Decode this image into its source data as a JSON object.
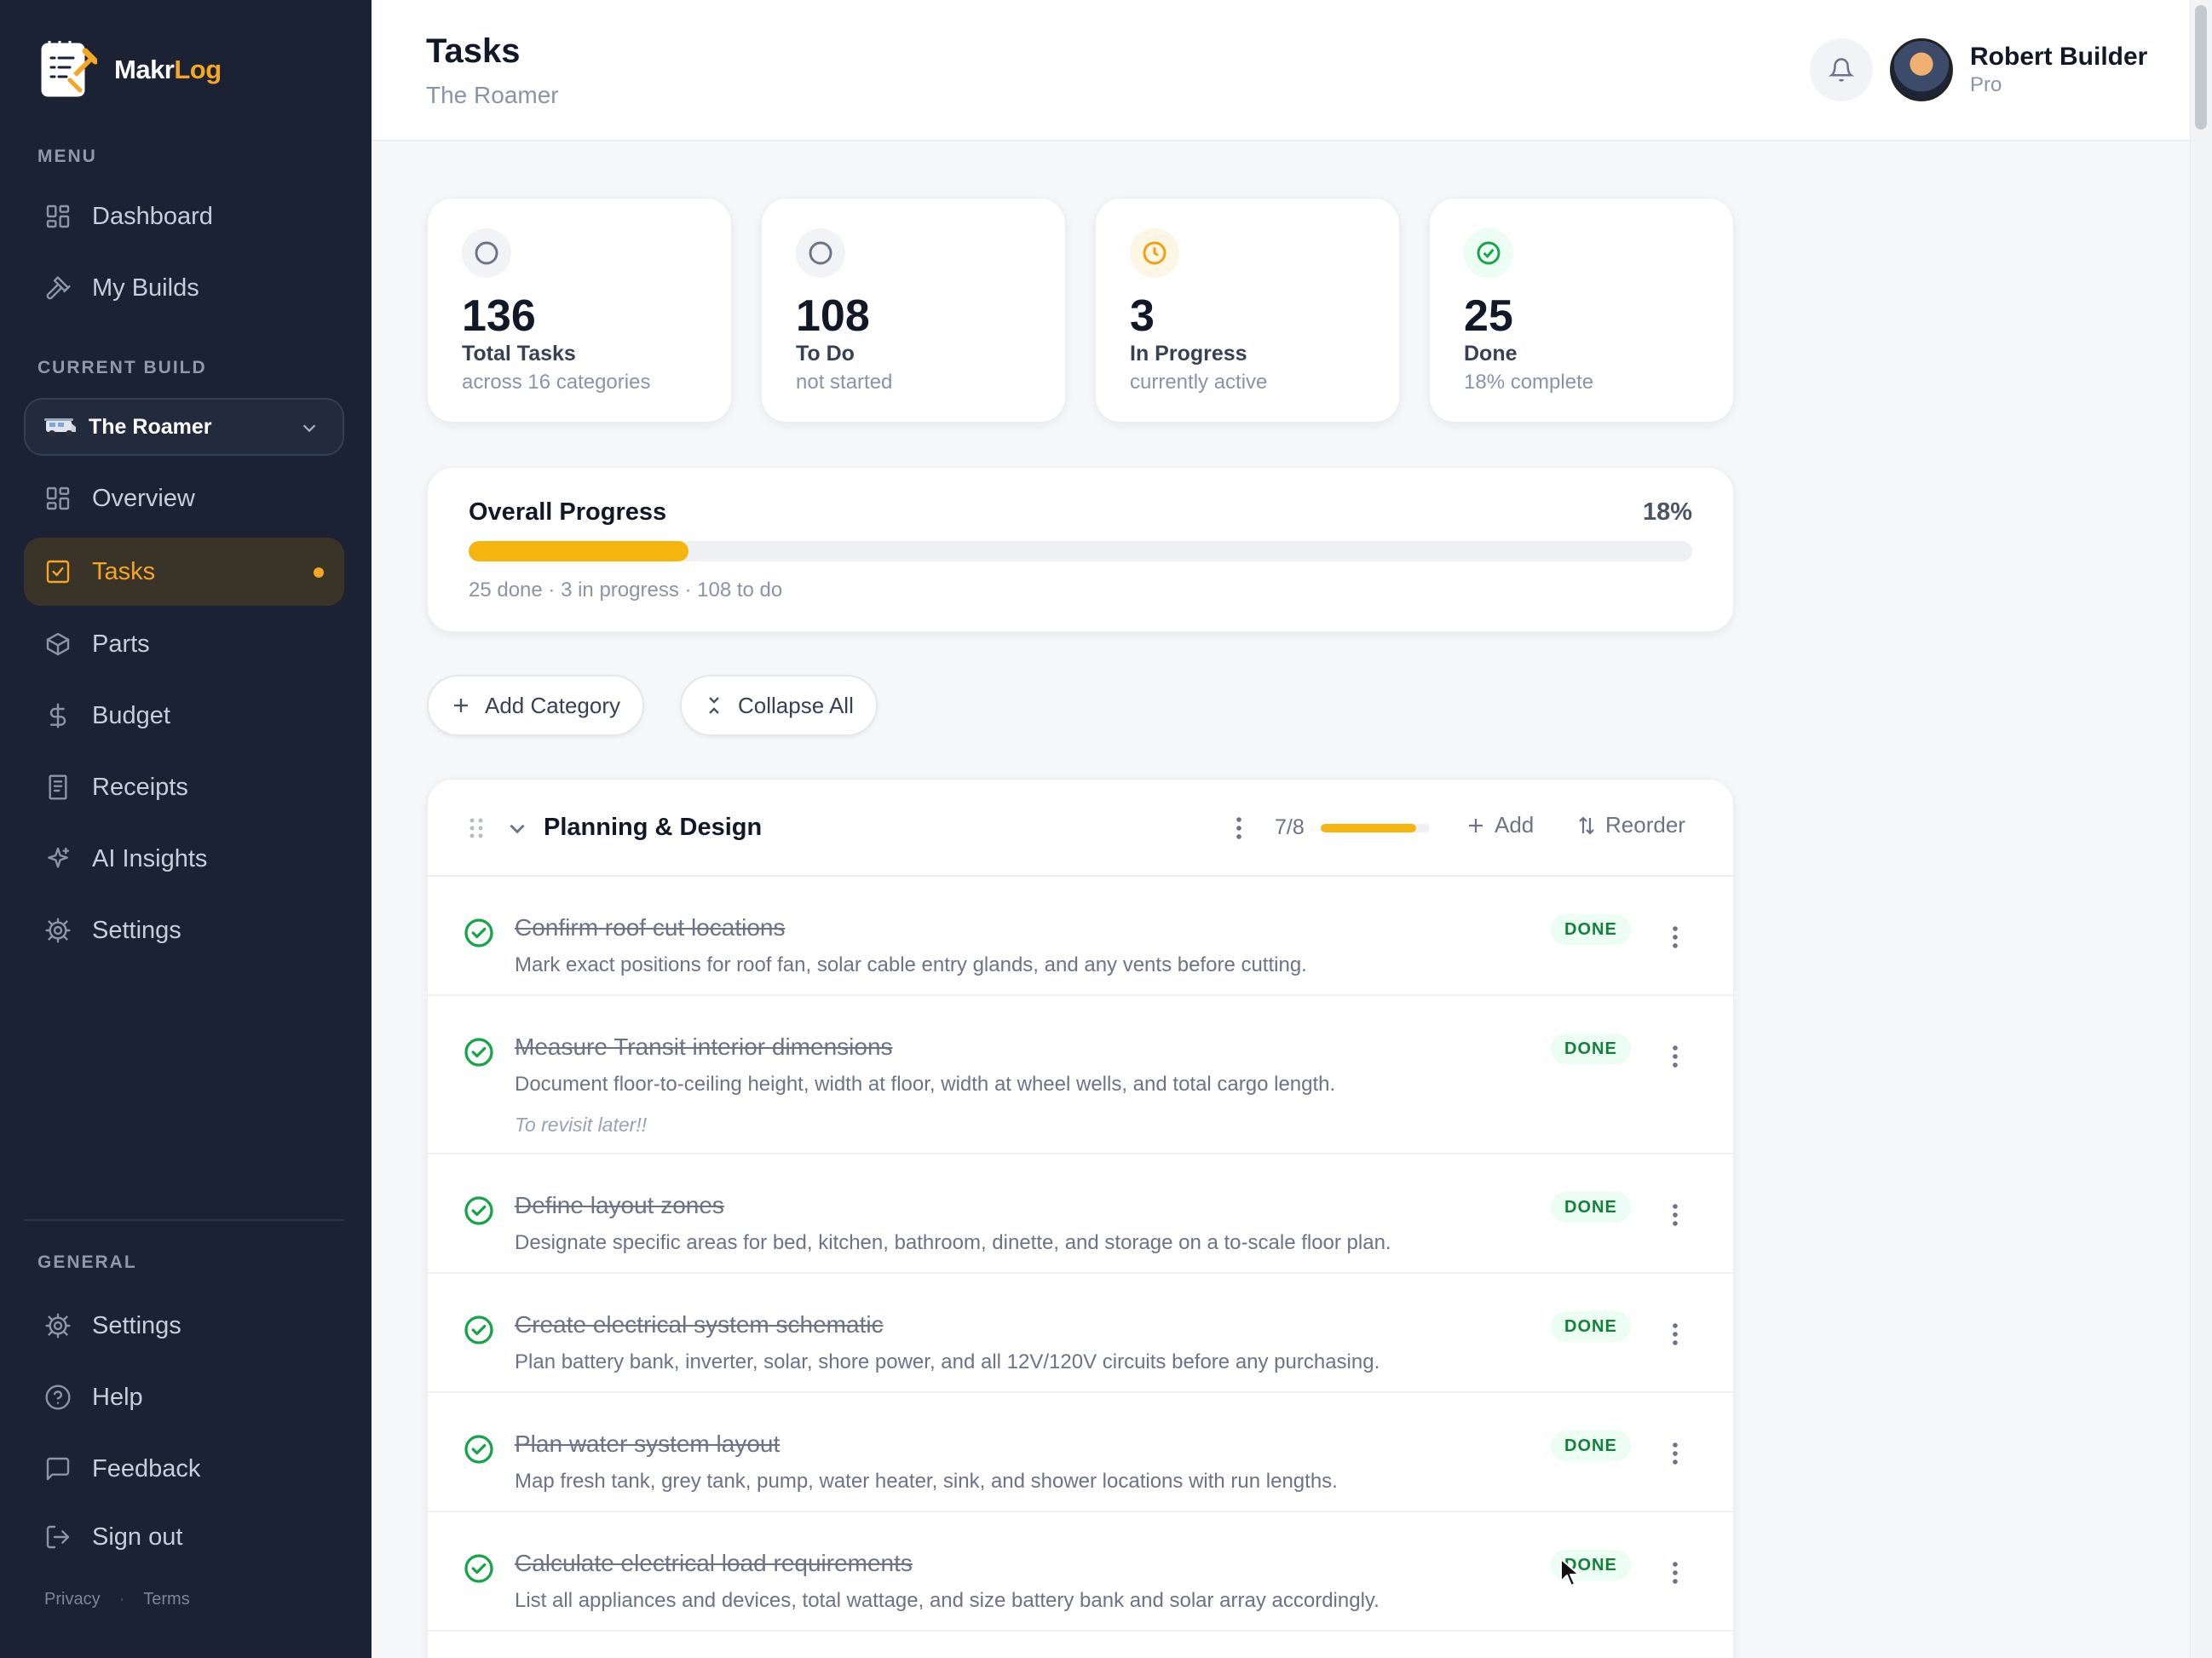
{
  "app": {
    "logo_prefix": "Makr",
    "logo_suffix": "Log",
    "accent_color": "#f5a623"
  },
  "sidebar": {
    "menu_label": "MENU",
    "menu_items": [
      {
        "label": "Dashboard",
        "icon": "grid-icon"
      },
      {
        "label": "My Builds",
        "icon": "hammer-icon"
      }
    ],
    "current_build_label": "CURRENT BUILD",
    "build_selector": {
      "value": "The Roamer",
      "icon": "van-icon"
    },
    "build_items": [
      {
        "label": "Overview",
        "icon": "grid-icon"
      },
      {
        "label": "Tasks",
        "icon": "checkbox-icon",
        "active": true
      },
      {
        "label": "Parts",
        "icon": "box-icon"
      },
      {
        "label": "Budget",
        "icon": "dollar-icon"
      },
      {
        "label": "Receipts",
        "icon": "receipt-icon"
      },
      {
        "label": "AI Insights",
        "icon": "sparkle-icon"
      },
      {
        "label": "Settings",
        "icon": "gear-icon"
      }
    ],
    "general_label": "GENERAL",
    "general_items": [
      {
        "label": "Settings",
        "icon": "gear-icon"
      },
      {
        "label": "Help",
        "icon": "help-icon"
      },
      {
        "label": "Feedback",
        "icon": "message-icon"
      },
      {
        "label": "Sign out",
        "icon": "logout-icon"
      }
    ],
    "footer": {
      "privacy": "Privacy",
      "separator": "·",
      "terms": "Terms"
    }
  },
  "header": {
    "title": "Tasks",
    "subtitle": "The Roamer",
    "user": {
      "name": "Robert Builder",
      "plan": "Pro"
    }
  },
  "stats": [
    {
      "value": "136",
      "label": "Total Tasks",
      "sub": "across 16 categories",
      "icon": "circle-icon",
      "color": "#6b7385"
    },
    {
      "value": "108",
      "label": "To Do",
      "sub": "not started",
      "icon": "circle-icon",
      "color": "#6b7385"
    },
    {
      "value": "3",
      "label": "In Progress",
      "sub": "currently active",
      "icon": "clock-icon",
      "color": "#f59e0b"
    },
    {
      "value": "25",
      "label": "Done",
      "sub": "18% complete",
      "icon": "check-circle-icon",
      "color": "#16a34a"
    }
  ],
  "progress": {
    "title": "Overall Progress",
    "percent_label": "18%",
    "fraction": 0.18,
    "meta": "25 done · 3 in progress · 108 to do"
  },
  "actions": {
    "add_category": "Add Category",
    "collapse_all": "Collapse All"
  },
  "category": {
    "title": "Planning & Design",
    "count": "7/8",
    "fraction": 0.875,
    "add_label": "Add",
    "reorder_label": "Reorder",
    "tasks": [
      {
        "title": "Confirm roof cut locations",
        "desc": "Mark exact positions for roof fan, solar cable entry glands, and any vents before cutting.",
        "status": "DONE"
      },
      {
        "title": "Measure Transit interior dimensions",
        "desc": "Document floor-to-ceiling height, width at floor, width at wheel wells, and total cargo length.",
        "note": "To revisit later!!",
        "status": "DONE"
      },
      {
        "title": "Define layout zones",
        "desc": "Designate specific areas for bed, kitchen, bathroom, dinette, and storage on a to-scale floor plan.",
        "status": "DONE"
      },
      {
        "title": "Create electrical system schematic",
        "desc": "Plan battery bank, inverter, solar, shore power, and all 12V/120V circuits before any purchasing.",
        "status": "DONE"
      },
      {
        "title": "Plan water system layout",
        "desc": "Map fresh tank, grey tank, pump, water heater, sink, and shower locations with run lengths.",
        "status": "DONE"
      },
      {
        "title": "Calculate electrical load requirements",
        "desc": "List all appliances and devices, total wattage, and size battery bank and solar array accordingly.",
        "status": "DONE"
      }
    ]
  }
}
